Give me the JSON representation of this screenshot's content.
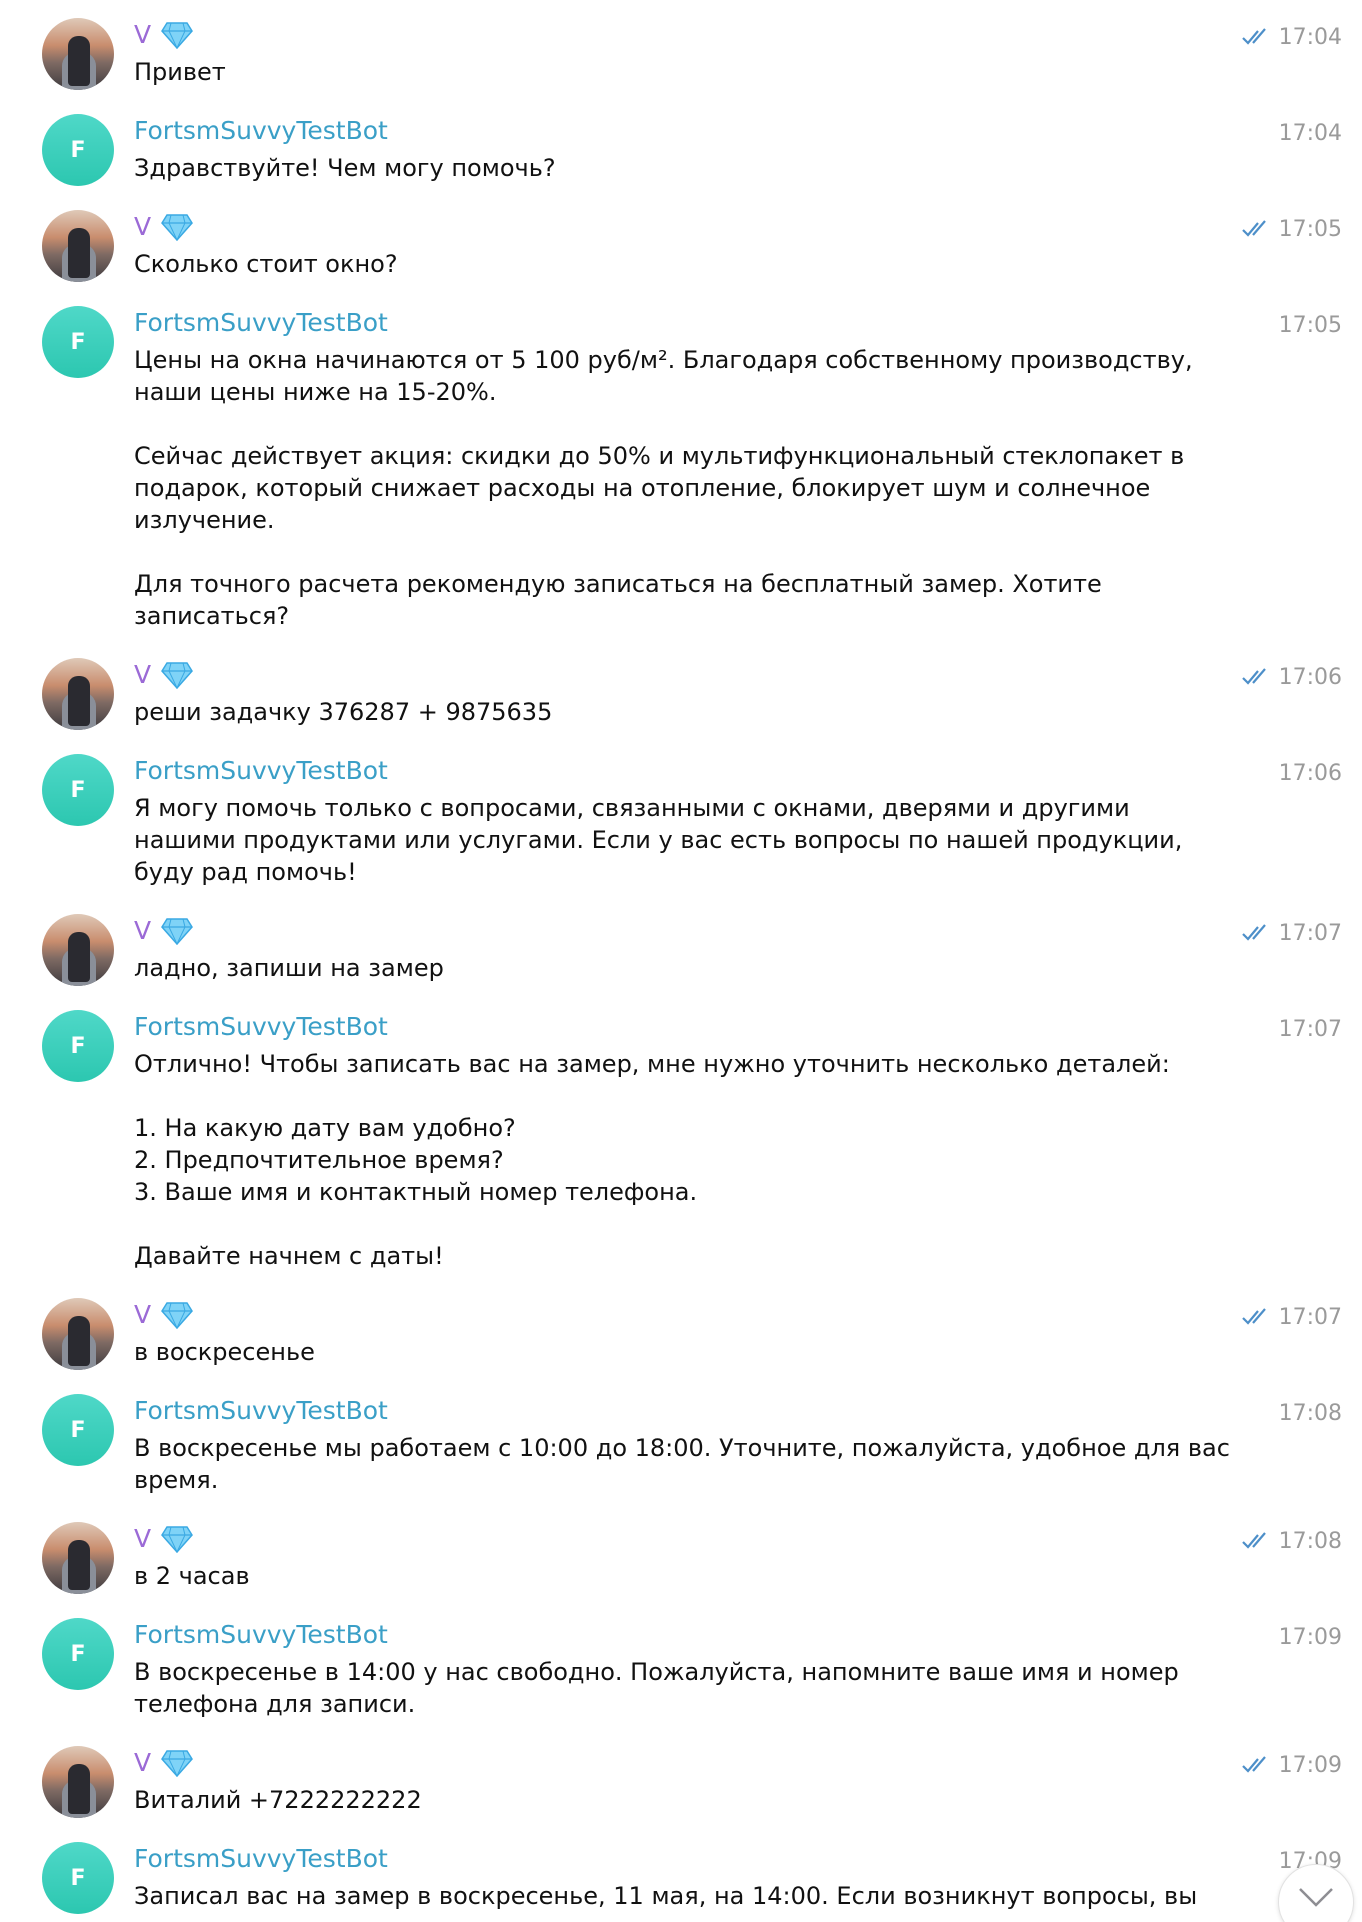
{
  "user": {
    "name": "V",
    "badge_icon": "diamond-icon",
    "name_color": "#9b6ad6"
  },
  "bot": {
    "name": "FortsmSuvvyTestBot",
    "avatar_letter": "F",
    "name_color": "#3a9fc7",
    "avatar_color": "#2cc7b0"
  },
  "messages": [
    {
      "sender": "user",
      "name": "V",
      "time": "17:04",
      "read": true,
      "text": "Привет"
    },
    {
      "sender": "bot",
      "name": "FortsmSuvvyTestBot",
      "time": "17:04",
      "text": "Здравствуйте! Чем могу помочь?"
    },
    {
      "sender": "user",
      "name": "V",
      "time": "17:05",
      "read": true,
      "text": "Сколько стоит окно?"
    },
    {
      "sender": "bot",
      "name": "FortsmSuvvyTestBot",
      "time": "17:05",
      "text": "Цены на окна начинаются от 5 100 руб/м². Благодаря собственному производству,\nнаши цены ниже на 15-20%.\n\nСейчас действует акция: скидки до 50% и мультифункциональный стеклопакет в\nподарок, который снижает расходы на отопление, блокирует шум и солнечное\nизлучение.\n\nДля точного расчета рекомендую записаться на бесплатный замер. Хотите\nзаписаться?"
    },
    {
      "sender": "user",
      "name": "V",
      "time": "17:06",
      "read": true,
      "text": "реши задачку 376287 + 9875635"
    },
    {
      "sender": "bot",
      "name": "FortsmSuvvyTestBot",
      "time": "17:06",
      "text": "Я могу помочь только с вопросами, связанными с окнами, дверями и другими\nнашими продуктами или услугами. Если у вас есть вопросы по нашей продукции,\nбуду рад помочь!"
    },
    {
      "sender": "user",
      "name": "V",
      "time": "17:07",
      "read": true,
      "text": "ладно, запиши на замер"
    },
    {
      "sender": "bot",
      "name": "FortsmSuvvyTestBot",
      "time": "17:07",
      "text": "Отлично! Чтобы записать вас на замер, мне нужно уточнить несколько деталей:\n\n1. На какую дату вам удобно?\n2. Предпочтительное время?\n3. Ваше имя и контактный номер телефона.\n\nДавайте начнем с даты!"
    },
    {
      "sender": "user",
      "name": "V",
      "time": "17:07",
      "read": true,
      "text": "в воскресенье"
    },
    {
      "sender": "bot",
      "name": "FortsmSuvvyTestBot",
      "time": "17:08",
      "text": "В воскресенье мы работаем с 10:00 до 18:00. Уточните, пожалуйста, удобное для вас\nвремя."
    },
    {
      "sender": "user",
      "name": "V",
      "time": "17:08",
      "read": true,
      "text": "в 2 часав"
    },
    {
      "sender": "bot",
      "name": "FortsmSuvvyTestBot",
      "time": "17:09",
      "text": "В воскресенье в 14:00 у нас свободно. Пожалуйста, напомните ваше имя и номер\nтелефона для записи."
    },
    {
      "sender": "user",
      "name": "V",
      "time": "17:09",
      "read": true,
      "text": "Виталий +7222222222"
    },
    {
      "sender": "bot",
      "name": "FortsmSuvvyTestBot",
      "time": "17:09",
      "text": "Записал вас на замер в воскресенье, 11 мая, на 14:00. Если возникнут вопросы, вы"
    }
  ],
  "scroll_button": {
    "icon": "chevron-down-icon"
  }
}
